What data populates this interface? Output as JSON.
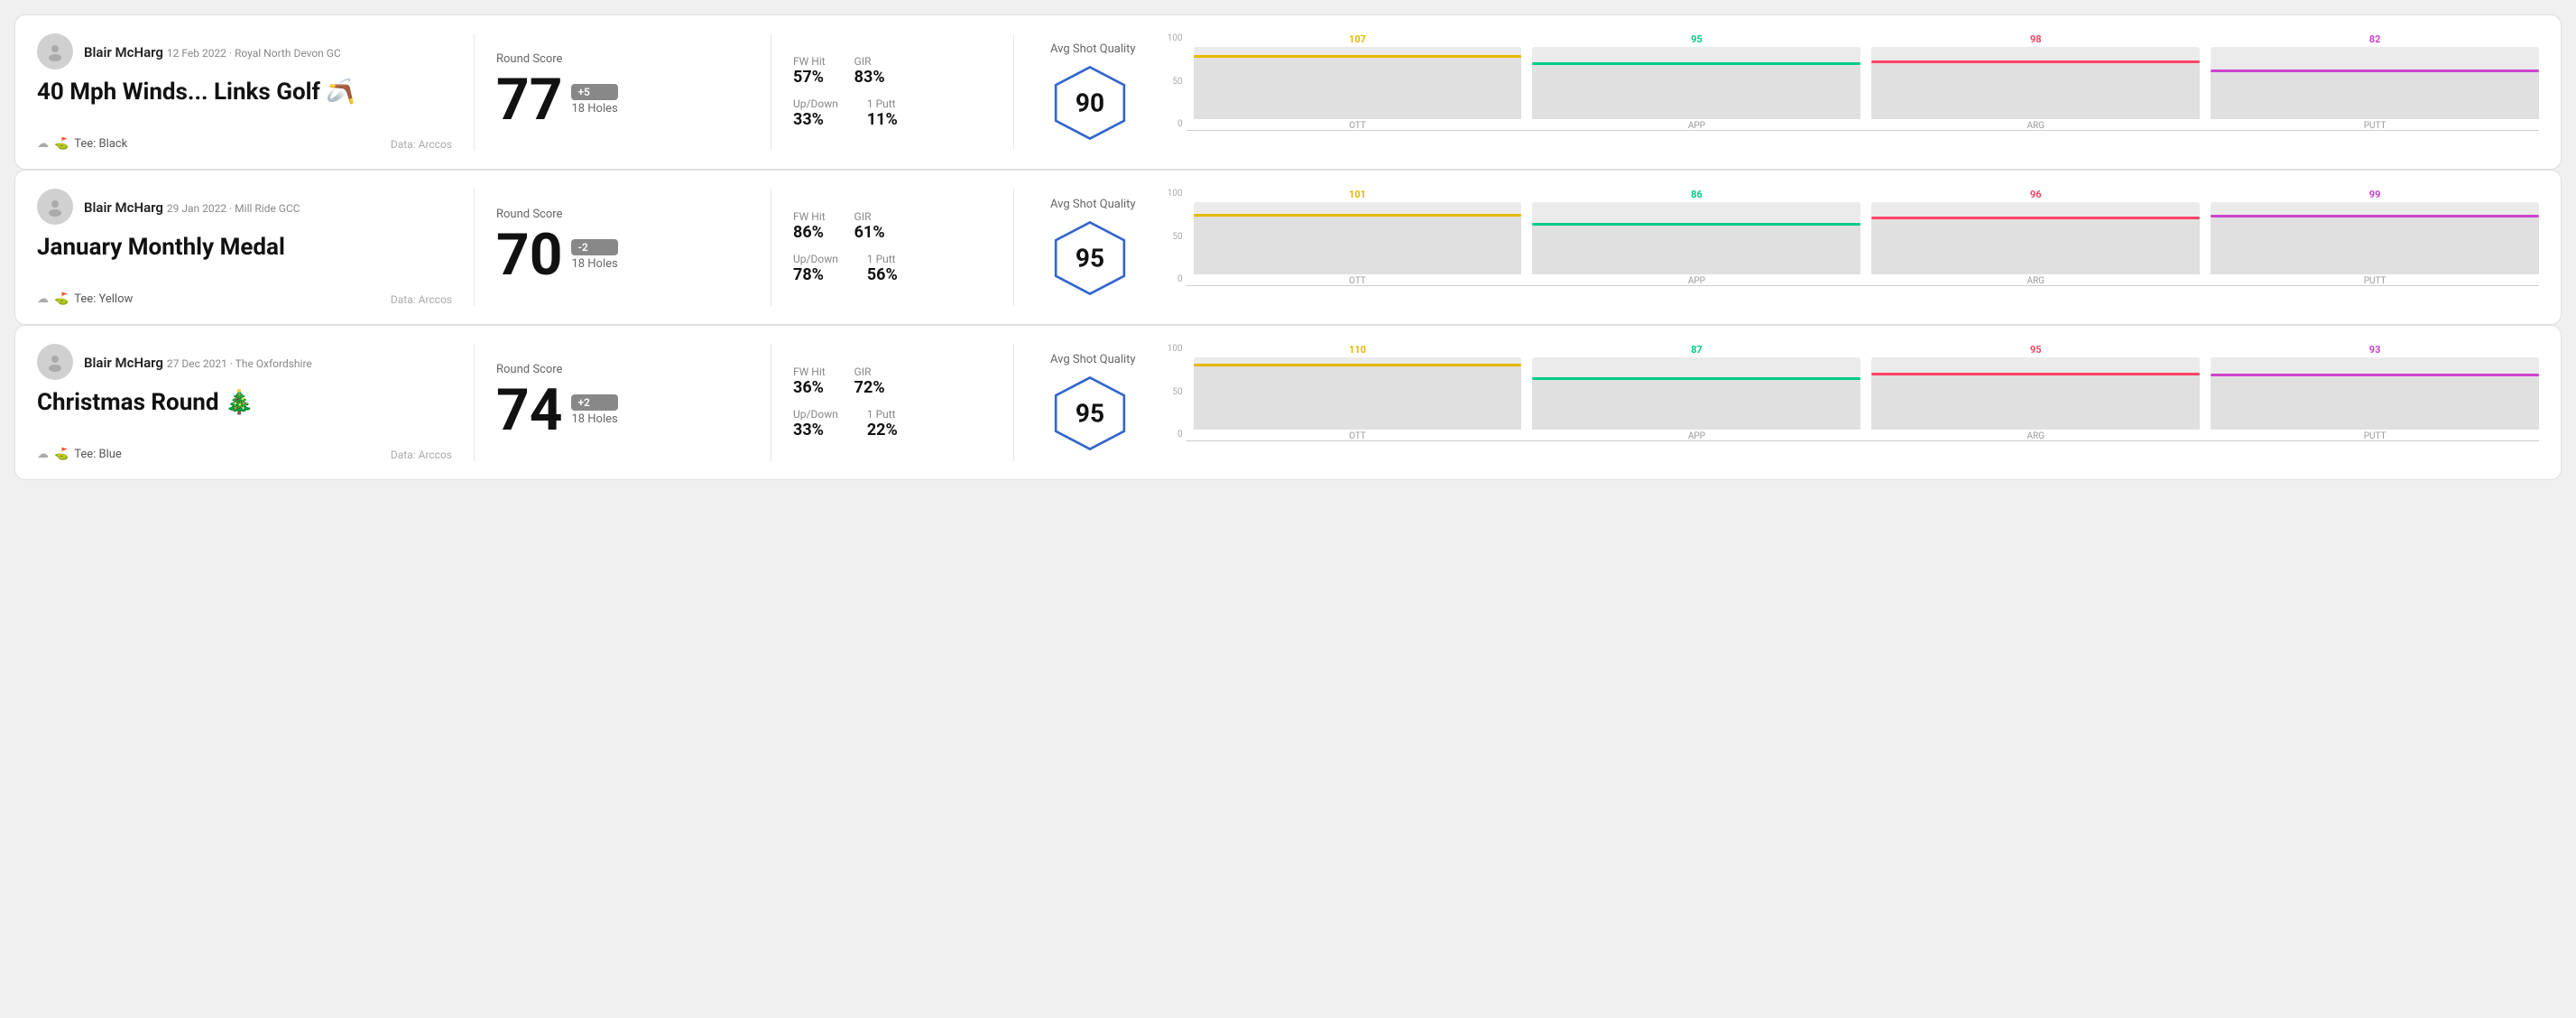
{
  "rounds": [
    {
      "id": "round1",
      "user": {
        "name": "Blair McHarg",
        "meta": "12 Feb 2022 · Royal North Devon GC"
      },
      "title": "40 Mph Winds... Links Golf 🪃",
      "tee": "Black",
      "data_source": "Data: Arccos",
      "score": "77",
      "score_diff": "+5",
      "holes": "18 Holes",
      "stats": {
        "fw_hit_label": "FW Hit",
        "fw_hit": "57%",
        "gir_label": "GIR",
        "gir": "83%",
        "up_down_label": "Up/Down",
        "up_down": "33%",
        "one_putt_label": "1 Putt",
        "one_putt": "11%"
      },
      "avg_shot_quality_label": "Avg Shot Quality",
      "hex_score": "90",
      "chart": {
        "bars": [
          {
            "label": "OTT",
            "value": 107,
            "color": "#e6b800"
          },
          {
            "label": "APP",
            "value": 95,
            "color": "#00cc88"
          },
          {
            "label": "ARG",
            "value": 98,
            "color": "#ff4466"
          },
          {
            "label": "PUTT",
            "value": 82,
            "color": "#cc44cc"
          }
        ],
        "y_labels": [
          "100",
          "50",
          "0"
        ]
      }
    },
    {
      "id": "round2",
      "user": {
        "name": "Blair McHarg",
        "meta": "29 Jan 2022 · Mill Ride GCC"
      },
      "title": "January Monthly Medal",
      "tee": "Yellow",
      "data_source": "Data: Arccos",
      "score": "70",
      "score_diff": "-2",
      "holes": "18 Holes",
      "stats": {
        "fw_hit_label": "FW Hit",
        "fw_hit": "86%",
        "gir_label": "GIR",
        "gir": "61%",
        "up_down_label": "Up/Down",
        "up_down": "78%",
        "one_putt_label": "1 Putt",
        "one_putt": "56%"
      },
      "avg_shot_quality_label": "Avg Shot Quality",
      "hex_score": "95",
      "chart": {
        "bars": [
          {
            "label": "OTT",
            "value": 101,
            "color": "#e6b800"
          },
          {
            "label": "APP",
            "value": 86,
            "color": "#00cc88"
          },
          {
            "label": "ARG",
            "value": 96,
            "color": "#ff4466"
          },
          {
            "label": "PUTT",
            "value": 99,
            "color": "#cc44cc"
          }
        ],
        "y_labels": [
          "100",
          "50",
          "0"
        ]
      }
    },
    {
      "id": "round3",
      "user": {
        "name": "Blair McHarg",
        "meta": "27 Dec 2021 · The Oxfordshire"
      },
      "title": "Christmas Round 🎄",
      "tee": "Blue",
      "data_source": "Data: Arccos",
      "score": "74",
      "score_diff": "+2",
      "holes": "18 Holes",
      "stats": {
        "fw_hit_label": "FW Hit",
        "fw_hit": "36%",
        "gir_label": "GIR",
        "gir": "72%",
        "up_down_label": "Up/Down",
        "up_down": "33%",
        "one_putt_label": "1 Putt",
        "one_putt": "22%"
      },
      "avg_shot_quality_label": "Avg Shot Quality",
      "hex_score": "95",
      "chart": {
        "bars": [
          {
            "label": "OTT",
            "value": 110,
            "color": "#e6b800"
          },
          {
            "label": "APP",
            "value": 87,
            "color": "#00cc88"
          },
          {
            "label": "ARG",
            "value": 95,
            "color": "#ff4466"
          },
          {
            "label": "PUTT",
            "value": 93,
            "color": "#cc44cc"
          }
        ],
        "y_labels": [
          "100",
          "50",
          "0"
        ]
      }
    }
  ],
  "labels": {
    "round_score": "Round Score",
    "fw_hit": "FW Hit",
    "gir": "GIR",
    "up_down": "Up/Down",
    "one_putt": "1 Putt",
    "avg_shot_quality": "Avg Shot Quality",
    "tee_prefix": "Tee: ",
    "data_arccos": "Data: Arccos"
  }
}
